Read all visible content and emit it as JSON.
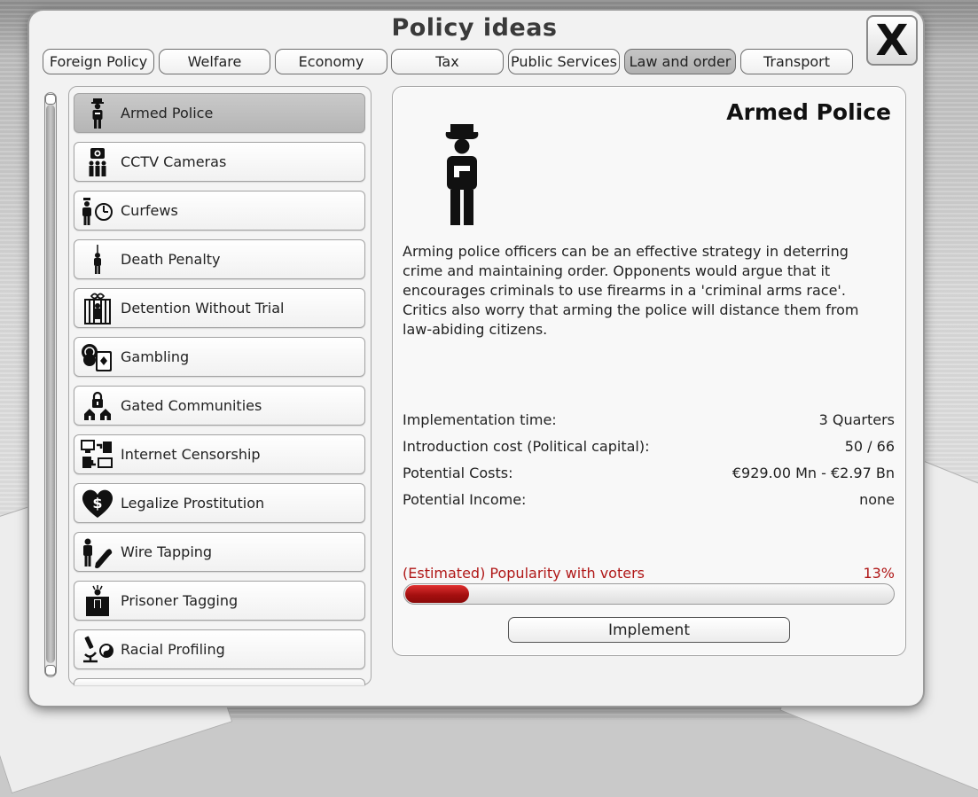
{
  "window": {
    "title": "Policy ideas",
    "close_label": "X"
  },
  "tabs": [
    {
      "label": "Foreign Policy"
    },
    {
      "label": "Welfare"
    },
    {
      "label": "Economy"
    },
    {
      "label": "Tax"
    },
    {
      "label": "Public Services"
    },
    {
      "label": "Law and order",
      "active": true
    },
    {
      "label": "Transport"
    }
  ],
  "policies": [
    {
      "label": "Armed Police",
      "icon": "police-gun-icon",
      "selected": true
    },
    {
      "label": "CCTV Cameras",
      "icon": "cctv-icon"
    },
    {
      "label": "Curfews",
      "icon": "clock-icon"
    },
    {
      "label": "Death Penalty",
      "icon": "hanging-icon"
    },
    {
      "label": "Detention Without Trial",
      "icon": "prison-bars-icon"
    },
    {
      "label": "Gambling",
      "icon": "coins-cards-icon"
    },
    {
      "label": "Gated Communities",
      "icon": "locked-houses-icon"
    },
    {
      "label": "Internet Censorship",
      "icon": "computers-icon"
    },
    {
      "label": "Legalize Prostitution",
      "icon": "heart-dollar-icon"
    },
    {
      "label": "Wire Tapping",
      "icon": "phone-icon"
    },
    {
      "label": "Prisoner Tagging",
      "icon": "tagged-prisoner-icon"
    },
    {
      "label": "Racial Profiling",
      "icon": "microscope-yinyang-icon"
    }
  ],
  "detail": {
    "title": "Armed Police",
    "description": "Arming police officers can be an effective strategy in deterring crime and maintaining order. Opponents would argue that it encourages criminals to use firearms in a 'criminal arms race'. Critics also worry that arming the police will distance them from law-abiding citizens.",
    "stats": [
      {
        "label": "Implementation time:",
        "value": "3 Quarters"
      },
      {
        "label": "Introduction cost (Political capital):",
        "value": "50 / 66"
      },
      {
        "label": "Potential Costs:",
        "value": "€929.00 Mn - €2.97 Bn"
      },
      {
        "label": "Potential Income:",
        "value": "none"
      }
    ],
    "popularity_label": "(Estimated) Popularity with voters",
    "popularity_value": "13%",
    "popularity_fraction": 0.13,
    "implement_label": "Implement"
  },
  "colors": {
    "popularity": "#b01818",
    "accent_selected": "#bdbdbd"
  }
}
